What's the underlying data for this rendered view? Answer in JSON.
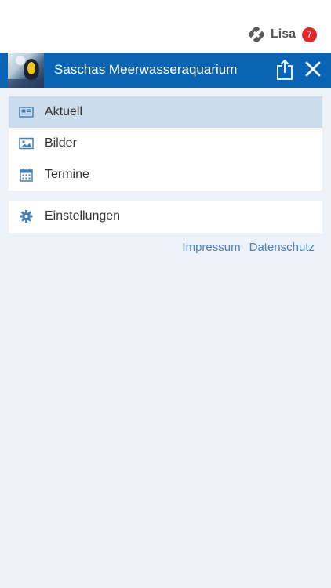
{
  "topbar": {
    "user_name": "Lisa",
    "notification_count": "7"
  },
  "header": {
    "title": "Saschas Meerwasseraquarium",
    "accent": "#0a64b4"
  },
  "menu": {
    "items": [
      {
        "label": "Aktuell",
        "icon": "newspaper-icon",
        "active": true
      },
      {
        "label": "Bilder",
        "icon": "image-icon",
        "active": false
      },
      {
        "label": "Termine",
        "icon": "calendar-icon",
        "active": false
      }
    ],
    "settings": {
      "label": "Einstellungen",
      "icon": "gear-icon"
    }
  },
  "footer_links": {
    "impressum": "Impressum",
    "datenschutz": "Datenschutz"
  }
}
